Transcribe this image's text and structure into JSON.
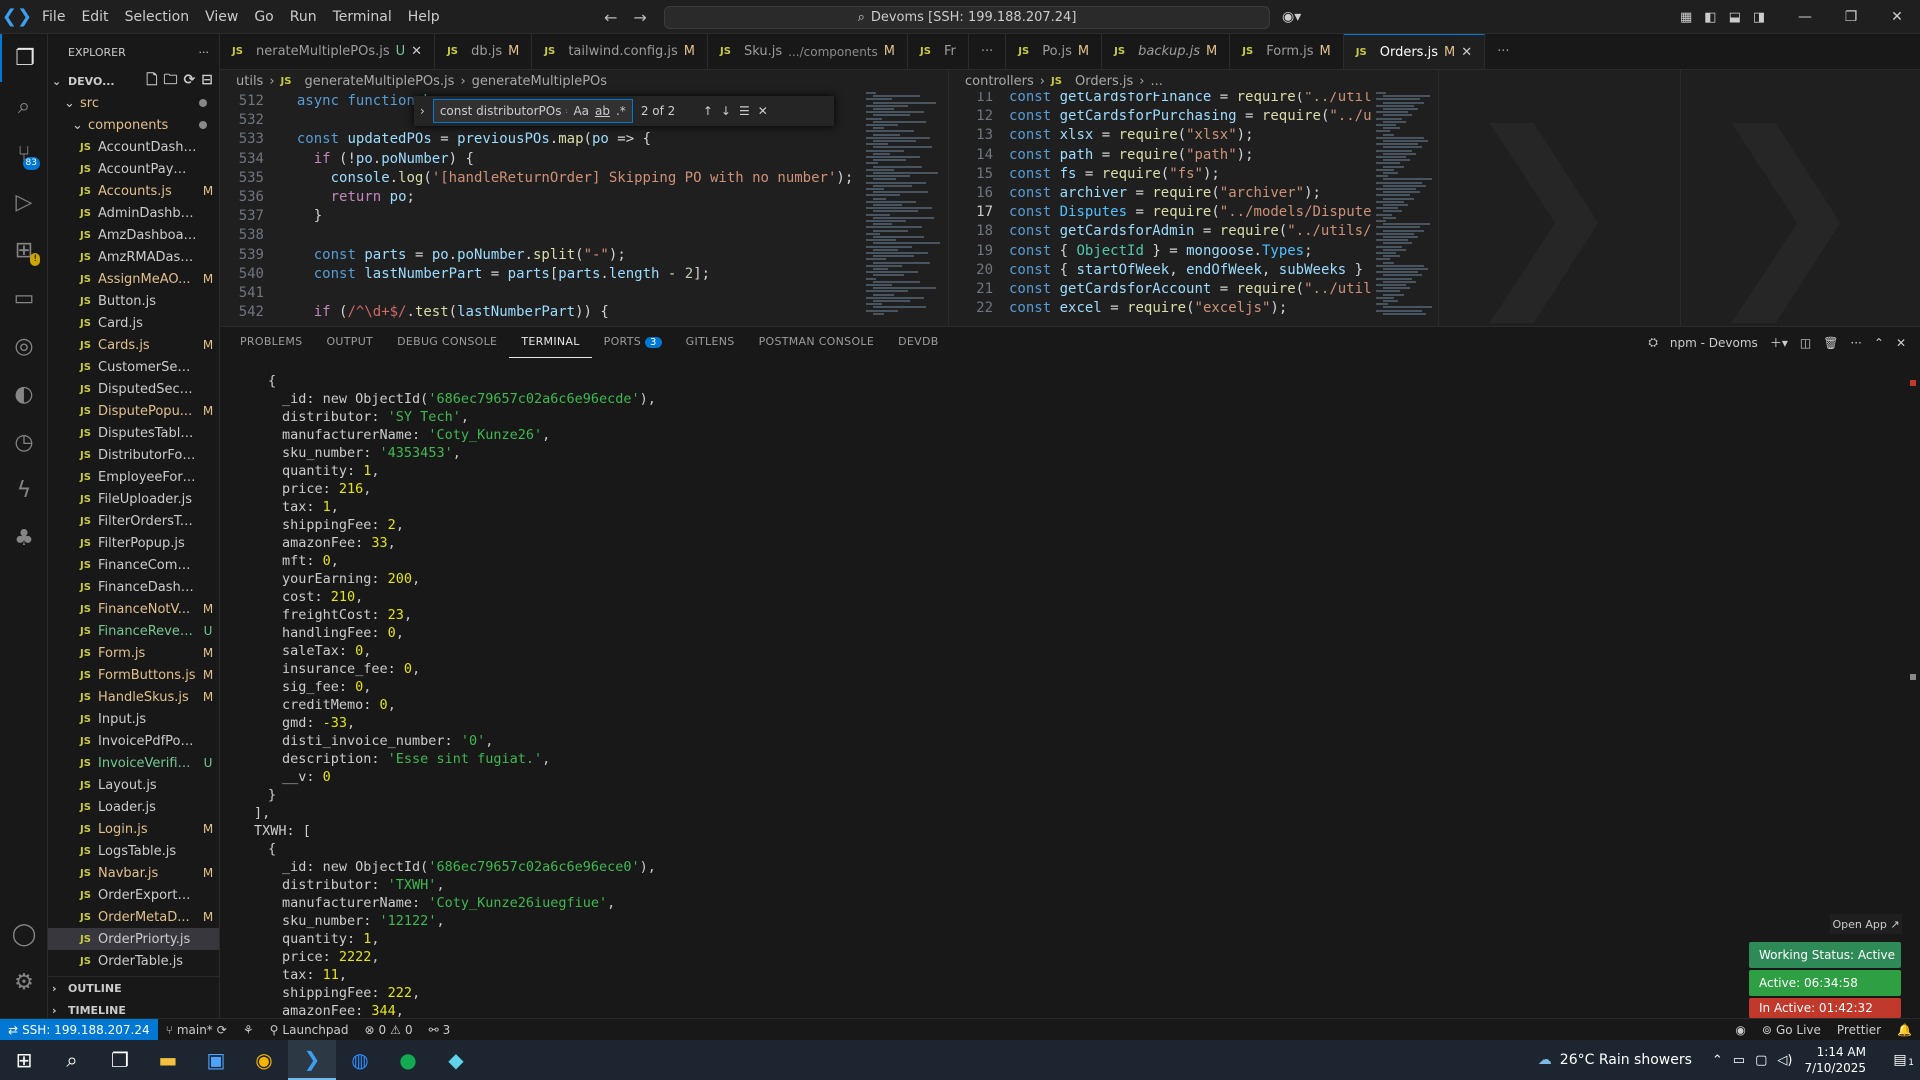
{
  "menu": [
    "File",
    "Edit",
    "Selection",
    "View",
    "Go",
    "Run",
    "Terminal",
    "Help"
  ],
  "command_center": "Devoms [SSH: 199.188.207.24]",
  "explorer": {
    "title": "EXPLORER",
    "root": "DEVO...",
    "src": "src",
    "components": "components",
    "files": [
      {
        "name": "AccountDashboar...",
        "status": ""
      },
      {
        "name": "AccountPaymentP...",
        "status": ""
      },
      {
        "name": "Accounts.js",
        "status": "M"
      },
      {
        "name": "AdminDashboard.js",
        "status": ""
      },
      {
        "name": "AmzDashboard.js",
        "status": ""
      },
      {
        "name": "AmzRMADashboar...",
        "status": ""
      },
      {
        "name": "AssignMeAO...",
        "status": "M"
      },
      {
        "name": "Button.js",
        "status": ""
      },
      {
        "name": "Card.js",
        "status": ""
      },
      {
        "name": "Cards.js",
        "status": "M"
      },
      {
        "name": "CustomerSection.js",
        "status": ""
      },
      {
        "name": "DisputedSection.js",
        "status": ""
      },
      {
        "name": "DisputePopu...",
        "status": "M"
      },
      {
        "name": "DisputesTable.js",
        "status": ""
      },
      {
        "name": "DistributorForm.js",
        "status": ""
      },
      {
        "name": "EmployeeForm.js",
        "status": ""
      },
      {
        "name": "FileUploader.js",
        "status": ""
      },
      {
        "name": "FilterOrdersTable.js",
        "status": ""
      },
      {
        "name": "FilterPopup.js",
        "status": ""
      },
      {
        "name": "FinanceComments.js",
        "status": ""
      },
      {
        "name": "FinanceDashboard.js",
        "status": ""
      },
      {
        "name": "FinanceNotV...",
        "status": "M"
      },
      {
        "name": "FinanceReveni...",
        "status": "U"
      },
      {
        "name": "Form.js",
        "status": "M"
      },
      {
        "name": "FormButtons.js",
        "status": "M"
      },
      {
        "name": "HandleSkus.js",
        "status": "M"
      },
      {
        "name": "Input.js",
        "status": ""
      },
      {
        "name": "InvoicePdfPopup.js",
        "status": ""
      },
      {
        "name": "InvoiceVerific...",
        "status": "U"
      },
      {
        "name": "Layout.js",
        "status": ""
      },
      {
        "name": "Loader.js",
        "status": ""
      },
      {
        "name": "Login.js",
        "status": "M"
      },
      {
        "name": "LogsTable.js",
        "status": ""
      },
      {
        "name": "Navbar.js",
        "status": "M"
      },
      {
        "name": "OrderExportPopup.js",
        "status": ""
      },
      {
        "name": "OrderMetaD...",
        "status": "M"
      },
      {
        "name": "OrderPriorty.js",
        "status": ""
      },
      {
        "name": "OrderTable.js",
        "status": ""
      }
    ],
    "outline": "OUTLINE",
    "timeline": "TIMELINE"
  },
  "tabs": [
    {
      "name": "nerateMultiplePOs.js",
      "status": "U",
      "active": false,
      "close": true
    },
    {
      "name": "db.js",
      "status": "M",
      "active": false
    },
    {
      "name": "tailwind.config.js",
      "status": "M",
      "active": false
    },
    {
      "name": "Sku.js",
      "extra": ".../components",
      "status": "M",
      "active": false
    },
    {
      "name": "Fr",
      "status": "",
      "active": false
    },
    {
      "name": "Po.js",
      "status": "M",
      "active": false
    },
    {
      "name": "backup.js",
      "status": "M",
      "active": false
    },
    {
      "name": "Form.js",
      "status": "M",
      "active": false
    },
    {
      "name": "Orders.js",
      "status": "M",
      "active": true,
      "close": true
    }
  ],
  "left_editor": {
    "breadcrumb": [
      "utils",
      "generateMultiplePOs.js",
      "generateMultiplePOs"
    ],
    "find": {
      "query": "const distributorPOs = [];",
      "count": "2 of 2",
      "case": "Aa",
      "word": "ab"
    },
    "lines": [
      {
        "n": "512",
        "t": "  async function h"
      },
      {
        "n": "532",
        "t": ""
      },
      {
        "n": "533",
        "t": "  const updatedPOs = previousPOs.map(po => {"
      },
      {
        "n": "534",
        "t": "    if (!po.poNumber) {"
      },
      {
        "n": "535",
        "t": "      console.log('[handleReturnOrder] Skipping PO with no number');"
      },
      {
        "n": "536",
        "t": "      return po;"
      },
      {
        "n": "537",
        "t": "    }"
      },
      {
        "n": "538",
        "t": ""
      },
      {
        "n": "539",
        "t": "    const parts = po.poNumber.split(\"-\");"
      },
      {
        "n": "540",
        "t": "    const lastNumberPart = parts[parts.length - 2];"
      },
      {
        "n": "541",
        "t": ""
      },
      {
        "n": "542",
        "t": "    if (/^\\d+$/.test(lastNumberPart)) {"
      }
    ]
  },
  "right_editor": {
    "breadcrumb": [
      "controllers",
      "Orders.js",
      "..."
    ],
    "lines": [
      {
        "n": "11",
        "t": "const getCardsforFinance = require(\"../utils"
      },
      {
        "n": "12",
        "t": "const getCardsforPurchasing = require(\"../ut"
      },
      {
        "n": "13",
        "t": "const xlsx = require(\"xlsx\");"
      },
      {
        "n": "14",
        "t": "const path = require(\"path\");"
      },
      {
        "n": "15",
        "t": "const fs = require(\"fs\");"
      },
      {
        "n": "16",
        "t": "const archiver = require(\"archiver\");"
      },
      {
        "n": "17",
        "t": "const Disputes = require(\"../models/Disputes"
      },
      {
        "n": "18",
        "t": "const getCardsforAdmin = require(\"../utils/g"
      },
      {
        "n": "19",
        "t": "const { ObjectId } = mongoose.Types;"
      },
      {
        "n": "20",
        "t": "const { startOfWeek, endOfWeek, subWeeks } ="
      },
      {
        "n": "21",
        "t": "const getCardsforAccount = require(\"../utils"
      },
      {
        "n": "22",
        "t": "const excel = require(\"exceljs\");"
      }
    ]
  },
  "panel": {
    "tabs": [
      "PROBLEMS",
      "OUTPUT",
      "DEBUG CONSOLE",
      "TERMINAL",
      "PORTS",
      "GITLENS",
      "POSTMAN CONSOLE",
      "DEVDB"
    ],
    "ports_badge": "3",
    "terminal_name": "npm - Devoms"
  },
  "terminal_lines": [
    {
      "i": 1,
      "k": "{",
      "v": "",
      "t": "p"
    },
    {
      "i": 2,
      "k": "_id: new ObjectId(",
      "v": "'686ec79657c02a6c6e96ecde'",
      "t": "s",
      "e": "),"
    },
    {
      "i": 2,
      "k": "distributor: ",
      "v": "'SY Tech'",
      "t": "s",
      "e": ","
    },
    {
      "i": 2,
      "k": "manufacturerName: ",
      "v": "'Coty_Kunze26'",
      "t": "s",
      "e": ","
    },
    {
      "i": 2,
      "k": "sku_number: ",
      "v": "'4353453'",
      "t": "s",
      "e": ","
    },
    {
      "i": 2,
      "k": "quantity: ",
      "v": "1",
      "t": "n",
      "e": ","
    },
    {
      "i": 2,
      "k": "price: ",
      "v": "216",
      "t": "n",
      "e": ","
    },
    {
      "i": 2,
      "k": "tax: ",
      "v": "1",
      "t": "n",
      "e": ","
    },
    {
      "i": 2,
      "k": "shippingFee: ",
      "v": "2",
      "t": "n",
      "e": ","
    },
    {
      "i": 2,
      "k": "amazonFee: ",
      "v": "33",
      "t": "n",
      "e": ","
    },
    {
      "i": 2,
      "k": "mft: ",
      "v": "0",
      "t": "n",
      "e": ","
    },
    {
      "i": 2,
      "k": "yourEarning: ",
      "v": "200",
      "t": "n",
      "e": ","
    },
    {
      "i": 2,
      "k": "cost: ",
      "v": "210",
      "t": "n",
      "e": ","
    },
    {
      "i": 2,
      "k": "freightCost: ",
      "v": "23",
      "t": "n",
      "e": ","
    },
    {
      "i": 2,
      "k": "handlingFee: ",
      "v": "0",
      "t": "n",
      "e": ","
    },
    {
      "i": 2,
      "k": "saleTax: ",
      "v": "0",
      "t": "n",
      "e": ","
    },
    {
      "i": 2,
      "k": "insurance_fee: ",
      "v": "0",
      "t": "n",
      "e": ","
    },
    {
      "i": 2,
      "k": "sig_fee: ",
      "v": "0",
      "t": "n",
      "e": ","
    },
    {
      "i": 2,
      "k": "creditMemo: ",
      "v": "0",
      "t": "n",
      "e": ","
    },
    {
      "i": 2,
      "k": "gmd: ",
      "v": "-33",
      "t": "n",
      "e": ","
    },
    {
      "i": 2,
      "k": "disti_invoice_number: ",
      "v": "'0'",
      "t": "s",
      "e": ","
    },
    {
      "i": 2,
      "k": "description: ",
      "v": "'Esse sint fugiat.'",
      "t": "s",
      "e": ","
    },
    {
      "i": 2,
      "k": "__v: ",
      "v": "0",
      "t": "n",
      "e": ""
    },
    {
      "i": 1,
      "k": "}",
      "v": "",
      "t": "p"
    },
    {
      "i": 0,
      "k": "],",
      "v": "",
      "t": "p"
    },
    {
      "i": 0,
      "k": "TXWH: [",
      "v": "",
      "t": "p"
    },
    {
      "i": 1,
      "k": "{",
      "v": "",
      "t": "p"
    },
    {
      "i": 2,
      "k": "_id: new ObjectId(",
      "v": "'686ec79657c02a6c6e96ece0'",
      "t": "s",
      "e": "),"
    },
    {
      "i": 2,
      "k": "distributor: ",
      "v": "'TXWH'",
      "t": "s",
      "e": ","
    },
    {
      "i": 2,
      "k": "manufacturerName: ",
      "v": "'Coty_Kunze26iuegfiue'",
      "t": "s",
      "e": ","
    },
    {
      "i": 2,
      "k": "sku_number: ",
      "v": "'12122'",
      "t": "s",
      "e": ","
    },
    {
      "i": 2,
      "k": "quantity: ",
      "v": "1",
      "t": "n",
      "e": ","
    },
    {
      "i": 2,
      "k": "price: ",
      "v": "2222",
      "t": "n",
      "e": ","
    },
    {
      "i": 2,
      "k": "tax: ",
      "v": "11",
      "t": "n",
      "e": ","
    },
    {
      "i": 2,
      "k": "shippingFee: ",
      "v": "222",
      "t": "n",
      "e": ","
    },
    {
      "i": 2,
      "k": "amazonFee: ",
      "v": "344",
      "t": "n",
      "e": ","
    }
  ],
  "overlay": {
    "open_app": "Open App ↗",
    "working": "Working Status: Active",
    "active": "Active: 06:34:58",
    "inactive": "In Active: 01:42:32"
  },
  "status": {
    "remote": "SSH: 199.188.207.24",
    "branch": "main*",
    "launchpad": "Launchpad",
    "errors": "0",
    "warnings": "0",
    "ports": "3",
    "golive": "Go Live",
    "prettier": "Prettier"
  },
  "taskbar": {
    "weather": "26°C  Rain showers",
    "time": "1:14 AM",
    "date": "7/10/2025",
    "notif": "1"
  },
  "colors": {
    "accent": "#0078d4",
    "working": "#2e8b57",
    "active": "#2ea043",
    "inactive": "#c0392b"
  }
}
